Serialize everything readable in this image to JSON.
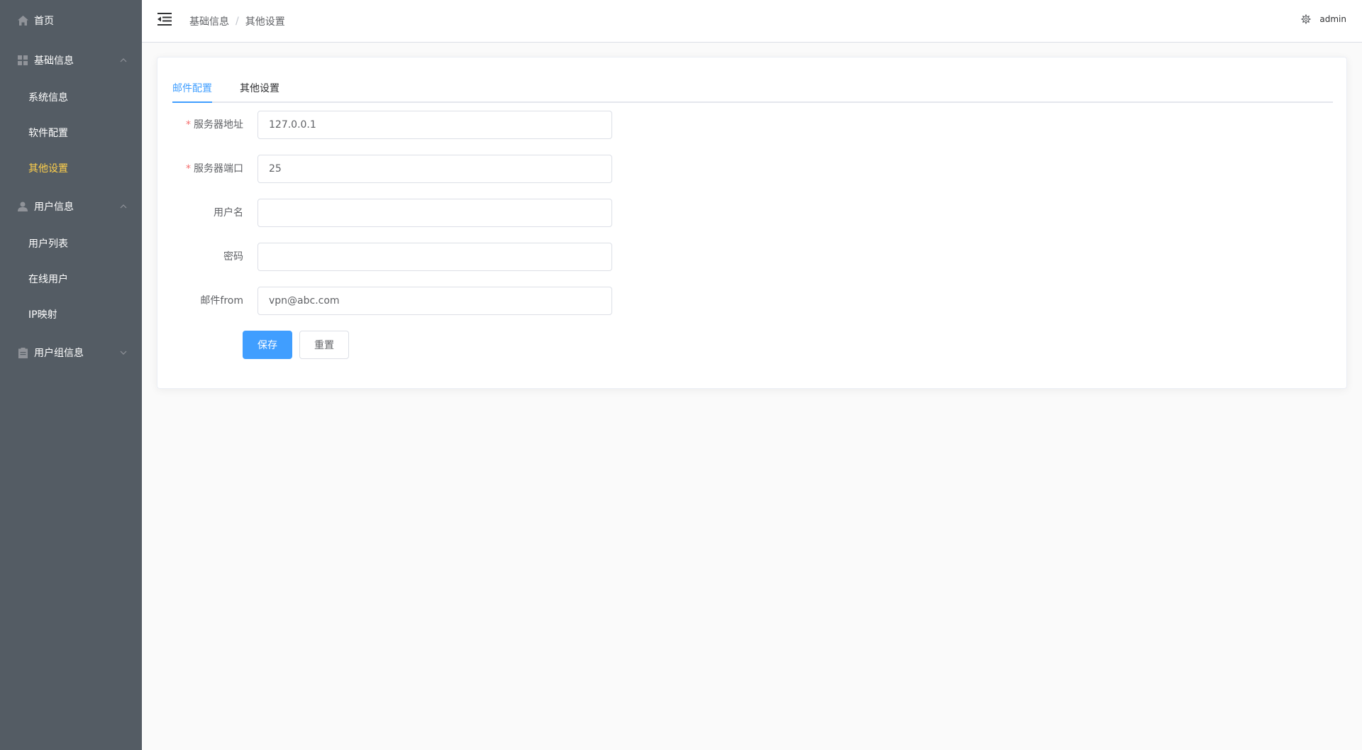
{
  "sidebar": {
    "items": [
      {
        "label": "首页",
        "icon": "home-icon"
      },
      {
        "label": "基础信息",
        "icon": "grid-icon",
        "expanded": true,
        "children": [
          {
            "label": "系统信息"
          },
          {
            "label": "软件配置"
          },
          {
            "label": "其他设置",
            "active": true
          }
        ]
      },
      {
        "label": "用户信息",
        "icon": "user-icon",
        "expanded": true,
        "children": [
          {
            "label": "用户列表"
          },
          {
            "label": "在线用户"
          },
          {
            "label": "IP映射"
          }
        ]
      },
      {
        "label": "用户组信息",
        "icon": "clipboard-icon",
        "expanded": false
      }
    ]
  },
  "header": {
    "breadcrumb": [
      "基础信息",
      "其他设置"
    ],
    "breadcrumb_sep": "/",
    "user": "admin"
  },
  "tabs": [
    {
      "label": "邮件配置",
      "active": true
    },
    {
      "label": "其他设置",
      "active": false
    }
  ],
  "form": {
    "fields": [
      {
        "label": "服务器地址",
        "required": true,
        "value": "127.0.0.1"
      },
      {
        "label": "服务器端口",
        "required": true,
        "value": "25"
      },
      {
        "label": "用户名",
        "required": false,
        "value": ""
      },
      {
        "label": "密码",
        "required": false,
        "value": ""
      },
      {
        "label": "邮件from",
        "required": false,
        "value": "vpn@abc.com"
      }
    ],
    "required_mark": "*",
    "save_label": "保存",
    "reset_label": "重置"
  },
  "colors": {
    "sidebar_bg": "#545c64",
    "sidebar_active": "#ffd04b",
    "primary": "#409eff",
    "required": "#f56c6c",
    "page_bg": "#fafafa"
  }
}
